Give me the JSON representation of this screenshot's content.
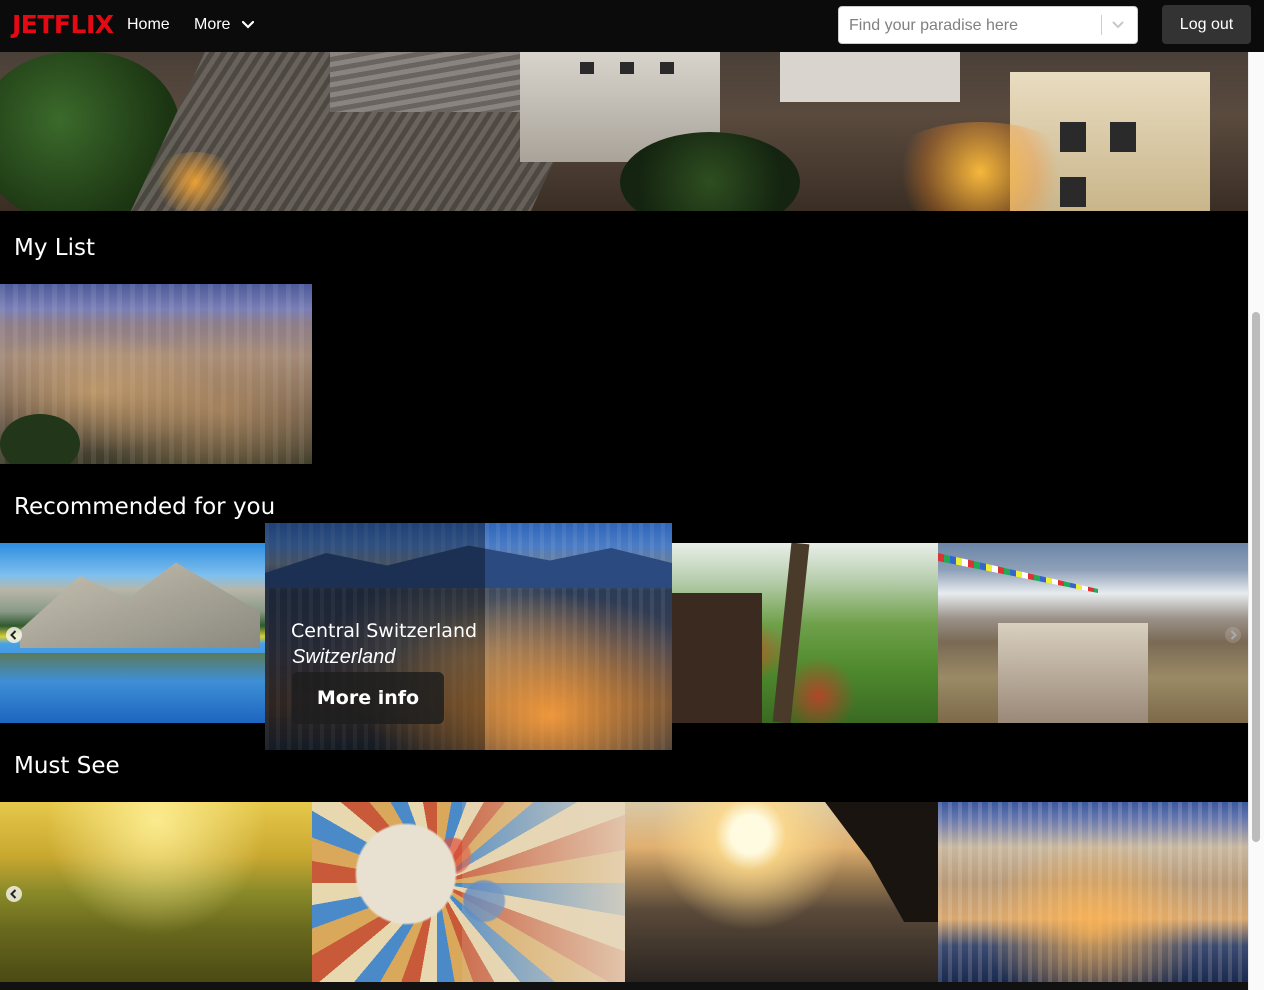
{
  "nav": {
    "logo": "JETFLIX",
    "home": "Home",
    "more": "More",
    "search_placeholder": "Find your paradise here",
    "logout": "Log out"
  },
  "rows": {
    "my_list": {
      "title": "My List"
    },
    "recommended": {
      "title": "Recommended for you",
      "hover_card": {
        "place": "Central Switzerland",
        "country": "Switzerland",
        "button": "More info"
      }
    },
    "must_see": {
      "title": "Must See"
    }
  },
  "colors": {
    "brand": "#e50914",
    "navbar": "#0b0b0b",
    "button": "#333333",
    "background": "#000000"
  }
}
